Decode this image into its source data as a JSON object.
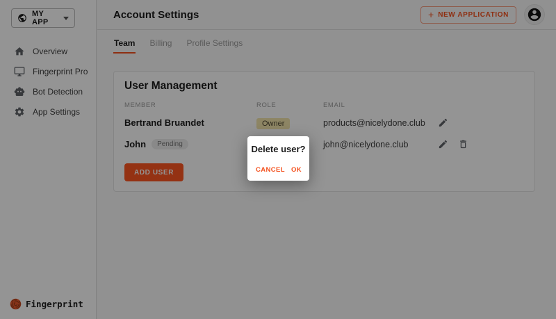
{
  "colors": {
    "accent": "#F4511E",
    "addUserBg": "#FF5722",
    "ownerBadgeBg": "#F3E5AC",
    "ownerBadgeText": "#4B4430",
    "pendingBg": "#ECECEC",
    "pendingText": "#757575",
    "hiddenRoleBadgeBg": "#EFBFB5",
    "overlay": "rgba(0,0,0,0.42)",
    "logoOrange": "#E8582B"
  },
  "app_selector": {
    "label": "MY APP",
    "icon": "globe-icon"
  },
  "sidebar": {
    "items": [
      {
        "label": "Overview",
        "icon": "home-icon"
      },
      {
        "label": "Fingerprint Pro",
        "icon": "monitor-icon"
      },
      {
        "label": "Bot Detection",
        "icon": "robot-icon"
      },
      {
        "label": "App Settings",
        "icon": "gear-icon"
      }
    ],
    "logo_text": "Fingerprint"
  },
  "header": {
    "title": "Account Settings",
    "new_application_plus": "+",
    "new_application_label": "NEW APPLICATION"
  },
  "tabs": [
    {
      "label": "Team",
      "active": true
    },
    {
      "label": "Billing",
      "active": false
    },
    {
      "label": "Profile Settings",
      "active": false
    }
  ],
  "user_management": {
    "title": "User Management",
    "columns": [
      "MEMBER",
      "ROLE",
      "EMAIL"
    ],
    "rows": [
      {
        "member": "Bertrand Bruandet",
        "role": "Owner",
        "email": "products@nicelydone.club"
      },
      {
        "member": "John",
        "status": "Pending",
        "email": "john@nicelydone.club"
      }
    ],
    "add_user_label": "ADD USER"
  },
  "dialog": {
    "title": "Delete user?",
    "cancel_label": "CANCEL",
    "ok_label": "OK"
  }
}
